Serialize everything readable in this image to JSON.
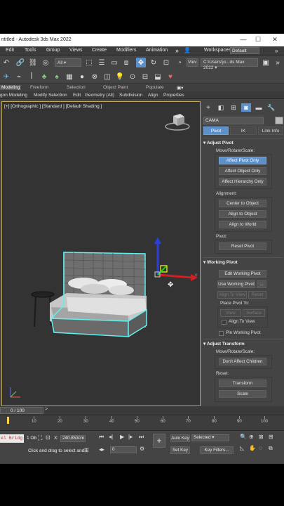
{
  "window": {
    "title": "ntitled - Autodesk 3ds Max 2022",
    "minimize": "—",
    "maximize": "☐",
    "close": "✕"
  },
  "menu": {
    "items": [
      "Edit",
      "Tools",
      "Group",
      "Views",
      "Create",
      "Modifiers",
      "Animation"
    ],
    "workspace_label": "Workspaces:",
    "workspace_value": "Default"
  },
  "toolbar": {
    "selection_filter": "All",
    "view_label": "Viev",
    "project_path": "C:\\Users\\jo...ds Max 2022"
  },
  "ribbon": {
    "tabs": [
      "Modeling",
      "Freeform",
      "Selection",
      "Object Paint",
      "Populate"
    ],
    "subtabs": [
      "gon Modeling",
      "Modify Selection",
      "Edit",
      "Geometry (All)",
      "Subdivision",
      "Align",
      "Properties"
    ]
  },
  "viewport": {
    "label": "[+] [Orthographic ] [Standard ] [Default Shading ]",
    "axis_x": "x"
  },
  "command_panel": {
    "object_name": "CAMA",
    "subtabs": [
      "Pivot",
      "IK",
      "Link Info"
    ],
    "adjust_pivot": {
      "title": "Adjust Pivot",
      "mrs_label": "Move/Rotate/Scale:",
      "buttons": [
        "Affect Pivot Only",
        "Affect Object Only",
        "Affect Hierarchy Only"
      ],
      "alignment_label": "Alignment:",
      "align_buttons": [
        "Center to Object",
        "Align to Object",
        "Align to World"
      ],
      "pivot_label": "Pivot:",
      "reset_pivot": "Reset Pivot"
    },
    "working_pivot": {
      "title": "Working Pivot",
      "edit_wp": "Edit Working Pivot",
      "use_wp": "Use Working Pivot",
      "more": "...",
      "align_to_view": "Align To View",
      "reset": "Reset",
      "place_pivot_to": "Place Pivot To:",
      "view": "View",
      "surface": "Surface",
      "align_to_view_chk": "Align To View",
      "pin_wp": "Pin Working Pivot"
    },
    "adjust_transform": {
      "title": "Adjust Transform",
      "mrs_label": "Move/Rotate/Scale:",
      "dont_affect": "Don't Affect Children",
      "reset_label": "Reset:",
      "transform": "Transform",
      "scale": "Scale"
    }
  },
  "timeline": {
    "frame": "0 / 100",
    "ticks": [
      "10",
      "20",
      "30",
      "40",
      "50",
      "60",
      "70",
      "80",
      "90",
      "100"
    ]
  },
  "status": {
    "script_text": "el Bridg",
    "selected_count": "1 Ob",
    "prompt": "Click and drag to select and",
    "x_field": "240.853cm",
    "frame_field": "0",
    "auto_key": "Auto Key",
    "set_key": "Set Key",
    "key_mode": "Selected",
    "key_filters": "Key Filters..."
  },
  "colors": {
    "accent": "#5d8fc8",
    "viewport_border": "#c2a85b",
    "selection": "#5ff0f0"
  }
}
